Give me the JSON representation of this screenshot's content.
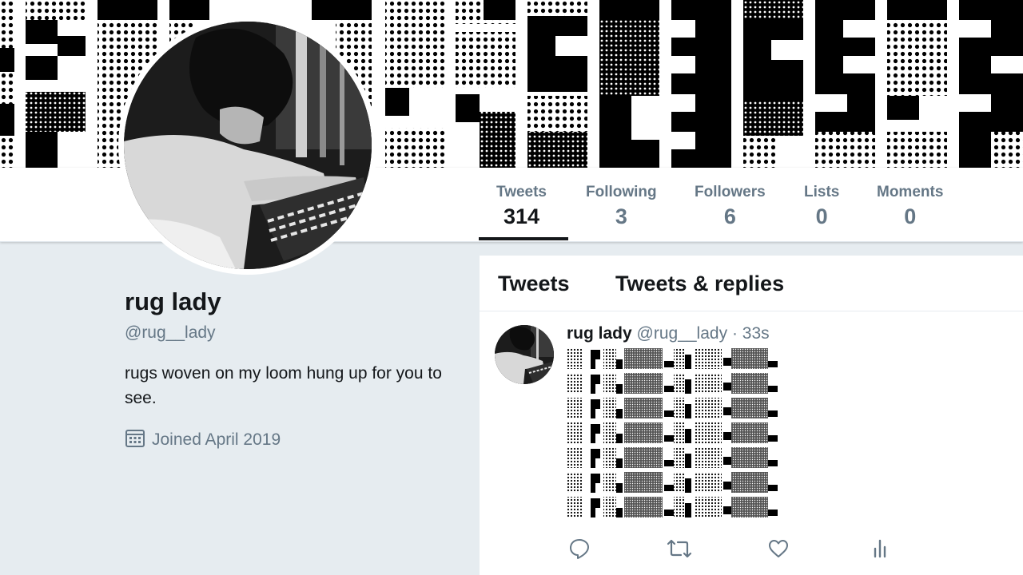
{
  "profile": {
    "name": "rug lady",
    "handle": "@rug__lady",
    "bio": "rugs woven on my loom hung up for you to see.",
    "joined": "Joined April 2019"
  },
  "stats": {
    "tweets_label": "Tweets",
    "tweets_value": "314",
    "following_label": "Following",
    "following_value": "3",
    "followers_label": "Followers",
    "followers_value": "6",
    "lists_label": "Lists",
    "lists_value": "0",
    "moments_label": "Moments",
    "moments_value": "0"
  },
  "timeline": {
    "tabs": [
      "Tweets",
      "Tweets & replies"
    ]
  },
  "tweet": {
    "name": "rug lady",
    "handle": "@rug__lady",
    "separator": "·",
    "time": "33s"
  },
  "icons": [
    "calendar-icon",
    "reply-icon",
    "retweet-icon",
    "like-icon",
    "analytics-icon"
  ],
  "colors": {
    "text_primary": "#14171a",
    "text_secondary": "#657786",
    "page_background": "#e6ecf0"
  }
}
